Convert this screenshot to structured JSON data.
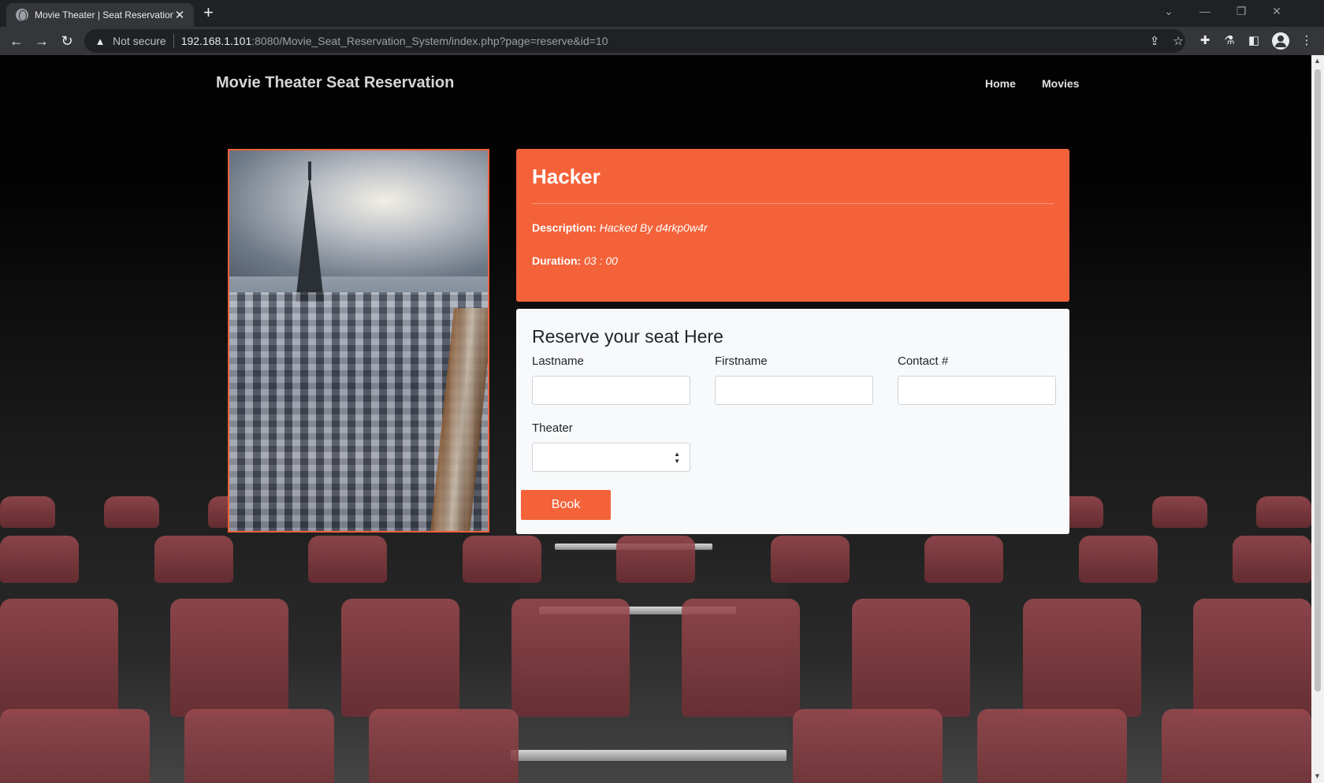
{
  "browser": {
    "tab_title": "Movie Theater | Seat Reservation",
    "new_tab": "+",
    "security_label": "Not secure",
    "url_host": "192.168.1.101",
    "url_rest": ":8080/Movie_Seat_Reservation_System/index.php?page=reserve&id=10"
  },
  "site": {
    "brand": "Movie Theater Seat Reservation",
    "nav": [
      "Home",
      "Movies"
    ]
  },
  "movie": {
    "title": "Hacker",
    "description_label": "Description:",
    "description": "Hacked By d4rkp0w4r",
    "duration_label": "Duration:",
    "duration": "03 : 00"
  },
  "reservation": {
    "heading": "Reserve your seat Here",
    "lastname_label": "Lastname",
    "firstname_label": "Firstname",
    "contact_label": "Contact #",
    "theater_label": "Theater",
    "lastname_value": "",
    "firstname_value": "",
    "contact_value": "",
    "theater_value": "",
    "book_label": "Book"
  },
  "colors": {
    "accent": "#f4623a",
    "card_bg": "#f8f9fa",
    "browser_bg": "#202124"
  }
}
